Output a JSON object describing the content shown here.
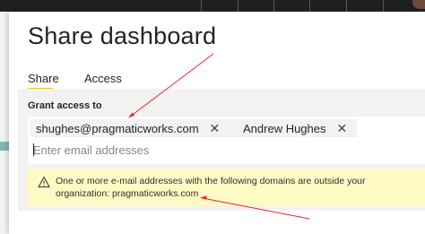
{
  "dialog": {
    "title": "Share dashboard"
  },
  "tabs": [
    {
      "label": "Share",
      "active": true
    },
    {
      "label": "Access",
      "active": false
    }
  ],
  "grant": {
    "label": "Grant access to",
    "chips": [
      {
        "label": "shughes@pragmaticworks.com"
      },
      {
        "label": "Andrew Hughes"
      }
    ],
    "input_placeholder": "Enter email addresses"
  },
  "warning": {
    "icon": "warning-triangle-icon",
    "text": "One or more e-mail addresses with the following domains are outside your organization: pragmaticworks.com"
  },
  "colors": {
    "accent": "#f2c811",
    "warning_bg": "#fff9c4",
    "annotation_arrow": "#e8262e"
  }
}
